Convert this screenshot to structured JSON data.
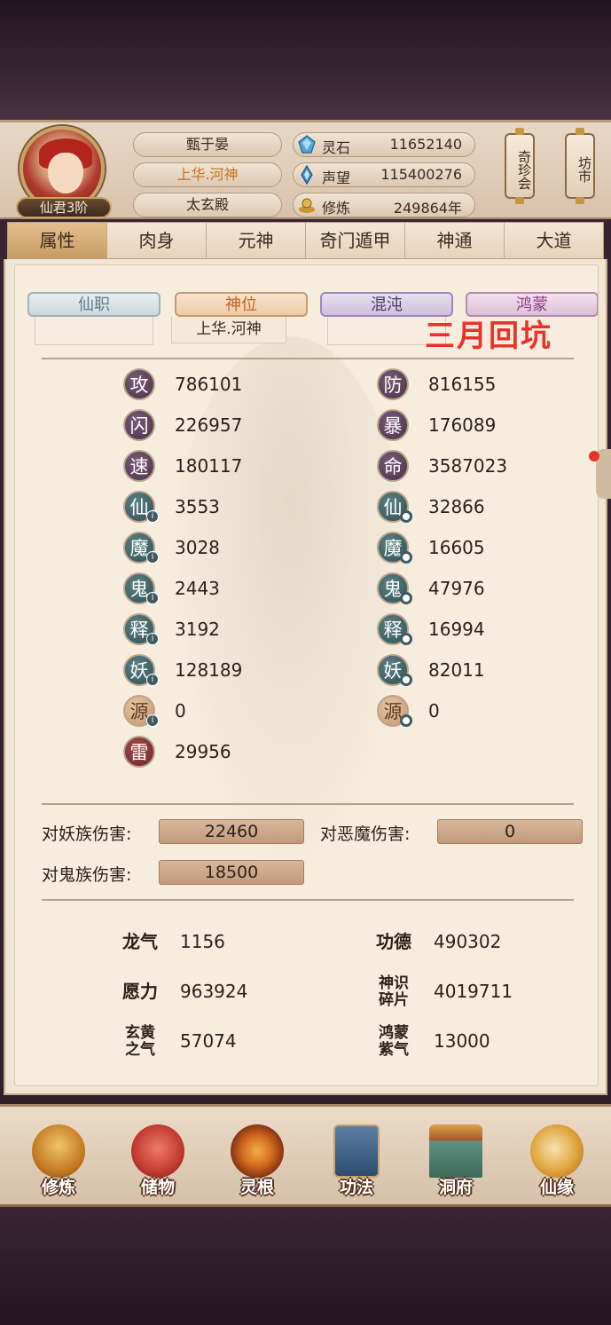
{
  "header": {
    "rank_badge": "仙君3阶",
    "name": "甄于晏",
    "title": "上华.河神",
    "sect": "太玄殿",
    "resources": [
      {
        "icon": "spirit-stone-icon",
        "label": "灵石",
        "value": "11652140"
      },
      {
        "icon": "reputation-icon",
        "label": "声望",
        "value": "115400276"
      },
      {
        "icon": "cultivation-icon",
        "label": "修炼",
        "value": "249864年"
      }
    ],
    "side_buttons": [
      "奇珍会",
      "坊市"
    ]
  },
  "tabs": [
    "属性",
    "肉身",
    "元神",
    "奇门遁甲",
    "神通",
    "大道"
  ],
  "active_tab": "属性",
  "ranks": {
    "tags": [
      "仙职",
      "神位",
      "混沌",
      "鸿蒙"
    ],
    "shenwei_value": "上华.河神"
  },
  "overlay_text": "三月回坑",
  "stats_left": [
    {
      "char": "攻",
      "value": "786101"
    },
    {
      "char": "闪",
      "value": "226957"
    },
    {
      "char": "速",
      "value": "180117"
    },
    {
      "char": "仙",
      "value": "3553"
    },
    {
      "char": "魔",
      "value": "3028"
    },
    {
      "char": "鬼",
      "value": "2443"
    },
    {
      "char": "释",
      "value": "3192"
    },
    {
      "char": "妖",
      "value": "128189"
    },
    {
      "char": "源",
      "value": "0"
    },
    {
      "char": "雷",
      "value": "29956"
    }
  ],
  "stats_right": [
    {
      "char": "防",
      "value": "816155"
    },
    {
      "char": "暴",
      "value": "176089"
    },
    {
      "char": "命",
      "value": "3587023"
    },
    {
      "char": "仙",
      "value": "32866"
    },
    {
      "char": "魔",
      "value": "16605"
    },
    {
      "char": "鬼",
      "value": "47976"
    },
    {
      "char": "释",
      "value": "16994"
    },
    {
      "char": "妖",
      "value": "82011"
    },
    {
      "char": "源",
      "value": "0"
    }
  ],
  "damage": {
    "yao_label": "对妖族伤害:",
    "yao_value": "22460",
    "demon_label": "对恶魔伤害:",
    "demon_value": "0",
    "ghost_label": "对鬼族伤害:",
    "ghost_value": "18500"
  },
  "extra": {
    "longqi_label": "龙气",
    "longqi_value": "1156",
    "gongde_label": "功德",
    "gongde_value": "490302",
    "yuanli_label": "愿力",
    "yuanli_value": "963924",
    "shenshi_label_1": "神识",
    "shenshi_label_2": "碎片",
    "shenshi_value": "4019711",
    "xuanhuang_label_1": "玄黄",
    "xuanhuang_label_2": "之气",
    "xuanhuang_value": "57074",
    "hongmeng_label_1": "鸿蒙",
    "hongmeng_label_2": "紫气",
    "hongmeng_value": "13000"
  },
  "nav": [
    "修炼",
    "储物",
    "灵根",
    "功法",
    "洞府",
    "仙缘"
  ]
}
